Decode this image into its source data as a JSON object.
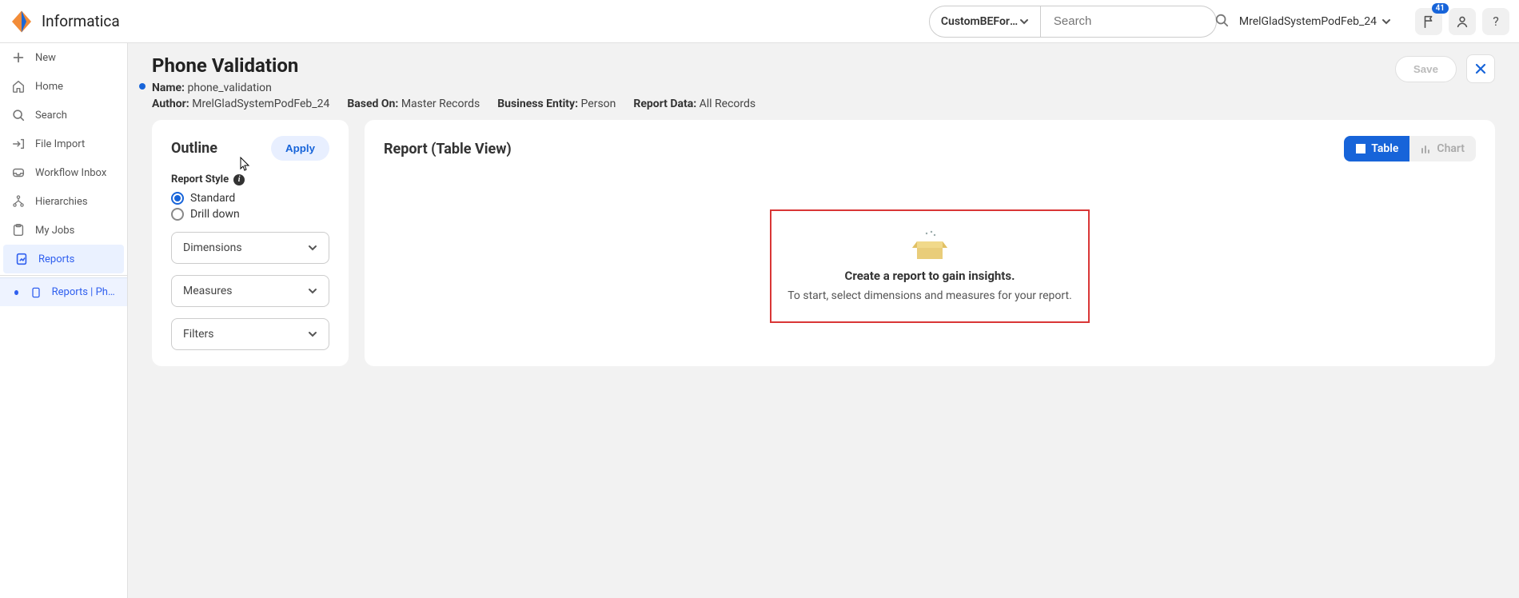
{
  "header": {
    "brand": "Informatica",
    "context_selected": "CustomBEForO…",
    "search_placeholder": "Search",
    "user_label": "MrelGladSystemPodFeb_24",
    "notification_count": "41"
  },
  "sidebar": {
    "new": "New",
    "home": "Home",
    "search": "Search",
    "file_import": "File Import",
    "workflow_inbox": "Workflow Inbox",
    "hierarchies": "Hierarchies",
    "my_jobs": "My Jobs",
    "reports": "Reports",
    "sub_report": "Reports | Phone …"
  },
  "page": {
    "title": "Phone Validation",
    "name_label": "Name:",
    "name_value": "phone_validation",
    "author_label": "Author:",
    "author_value": "MrelGladSystemPodFeb_24",
    "based_label": "Based On:",
    "based_value": "Master Records",
    "entity_label": "Business Entity:",
    "entity_value": "Person",
    "data_label": "Report Data:",
    "data_value": "All Records",
    "save": "Save"
  },
  "outline": {
    "title": "Outline",
    "apply": "Apply",
    "style_label": "Report Style",
    "radio_standard": "Standard",
    "radio_drilldown": "Drill down",
    "select_dimensions": "Dimensions",
    "select_measures": "Measures",
    "select_filters": "Filters"
  },
  "report": {
    "title": "Report (Table View)",
    "toggle_table": "Table",
    "toggle_chart": "Chart",
    "empty_title": "Create a report to gain insights.",
    "empty_sub": "To start, select dimensions and measures for your report."
  }
}
